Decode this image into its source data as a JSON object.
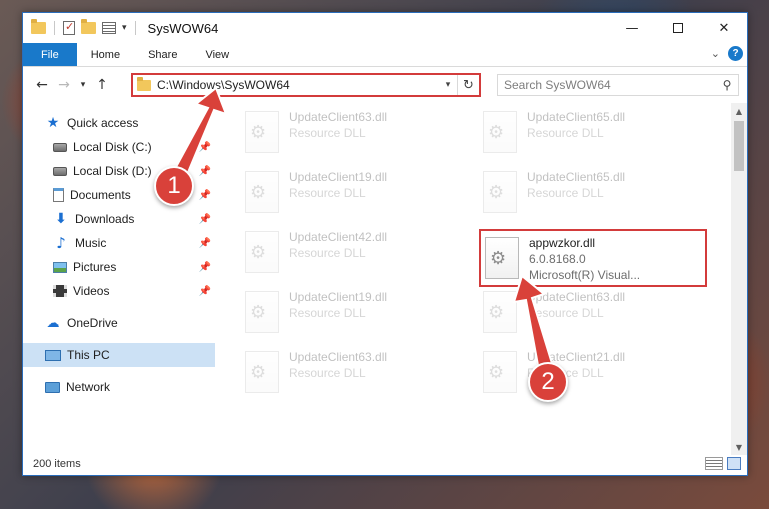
{
  "window": {
    "title": "SysWOW64",
    "caption": {
      "minimize": "—",
      "close": "✕"
    }
  },
  "ribbon": {
    "tabs": [
      "File",
      "Home",
      "Share",
      "View"
    ],
    "help": "?"
  },
  "address": {
    "path": "C:\\Windows\\SysWOW64"
  },
  "search": {
    "placeholder": "Search SysWOW64"
  },
  "sidebar": {
    "items": [
      {
        "label": "Quick access",
        "icon": "star-icon",
        "pinned": false
      },
      {
        "label": "Local Disk (C:)",
        "icon": "drive-icon",
        "pinned": true
      },
      {
        "label": "Local Disk (D:)",
        "icon": "drive-icon",
        "pinned": true
      },
      {
        "label": "Documents",
        "icon": "documents-icon",
        "pinned": true
      },
      {
        "label": "Downloads",
        "icon": "downloads-icon",
        "pinned": true
      },
      {
        "label": "Music",
        "icon": "music-icon",
        "pinned": true
      },
      {
        "label": "Pictures",
        "icon": "pictures-icon",
        "pinned": true
      },
      {
        "label": "Videos",
        "icon": "videos-icon",
        "pinned": true
      },
      {
        "label": "OneDrive",
        "icon": "onedrive-icon",
        "pinned": false
      },
      {
        "label": "This PC",
        "icon": "this-pc-icon",
        "pinned": false,
        "selected": true
      },
      {
        "label": "Network",
        "icon": "network-icon",
        "pinned": false
      }
    ]
  },
  "files": {
    "highlighted": {
      "name": "appwzkor.dll",
      "version": "6.0.8168.0",
      "company": "Microsoft(R) Visual..."
    },
    "ghost": [
      {
        "name": "UpdateClient63.dll",
        "desc": "Resource DLL"
      },
      {
        "name": "UpdateClient65.dll",
        "desc": "Resource DLL"
      },
      {
        "name": "UpdateClient19.dll",
        "desc": "Resource DLL"
      },
      {
        "name": "UpdateClient65.dll",
        "desc": "Resource DLL"
      },
      {
        "name": "UpdateClient42.dll",
        "desc": "Resource DLL"
      },
      {
        "name": "UpdateClient19.dll",
        "desc": "Resource DLL"
      },
      {
        "name": "UpdateClient63.dll",
        "desc": "Resource DLL"
      },
      {
        "name": "UpdateClient63.dll",
        "desc": "Resource DLL"
      },
      {
        "name": "UpdateClient21.dll",
        "desc": "Resource DLL"
      }
    ]
  },
  "status": {
    "item_count": "200 items"
  },
  "annotations": {
    "step1": "1",
    "step2": "2",
    "color": "#d9413a"
  }
}
